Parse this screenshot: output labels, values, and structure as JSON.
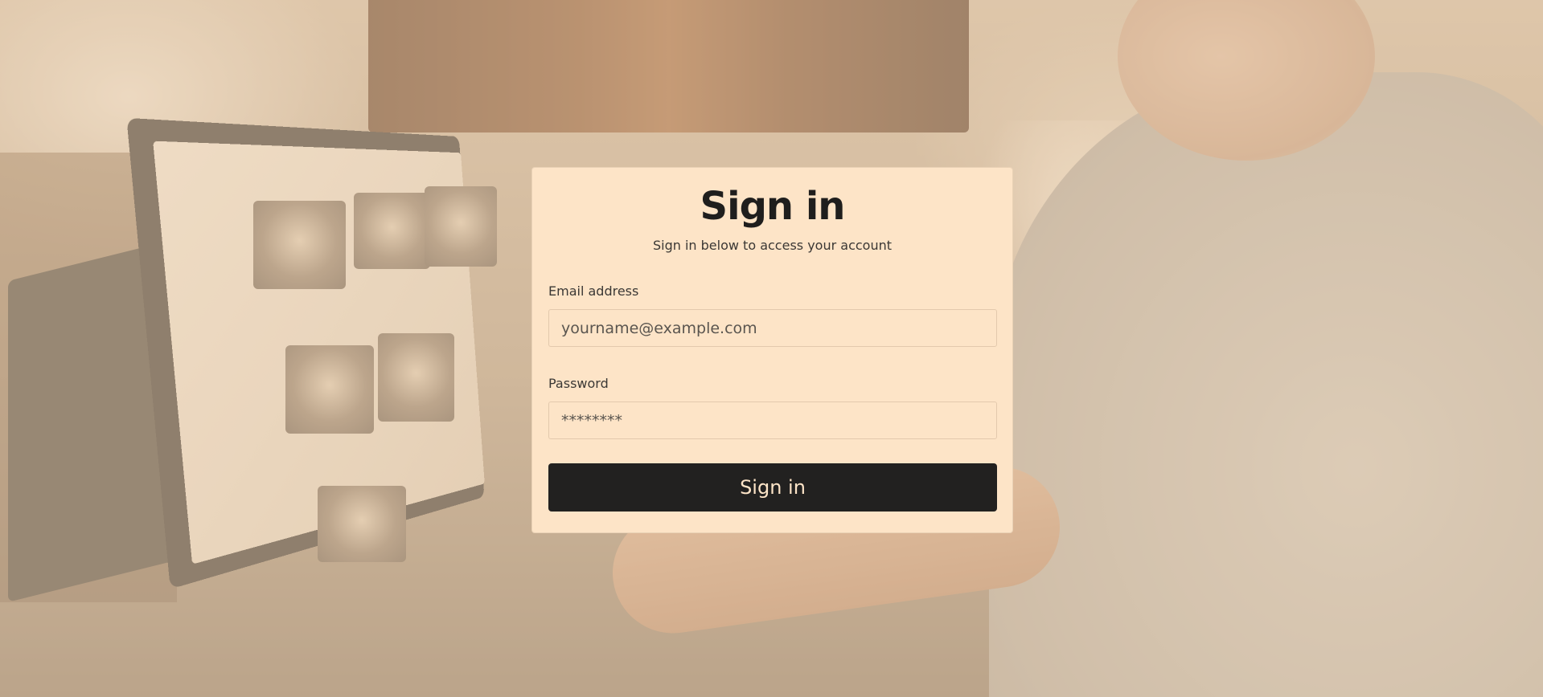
{
  "signin": {
    "title": "Sign in",
    "subtitle": "Sign in below to access your account",
    "email": {
      "label": "Email address",
      "placeholder": "yourname@example.com"
    },
    "password": {
      "label": "Password",
      "placeholder": "********"
    },
    "submit_label": "Sign in"
  },
  "colors": {
    "card_background": "#fde4c7",
    "button_background": "#222120",
    "button_text": "#fde4c7",
    "text": "#1f1e1d"
  }
}
